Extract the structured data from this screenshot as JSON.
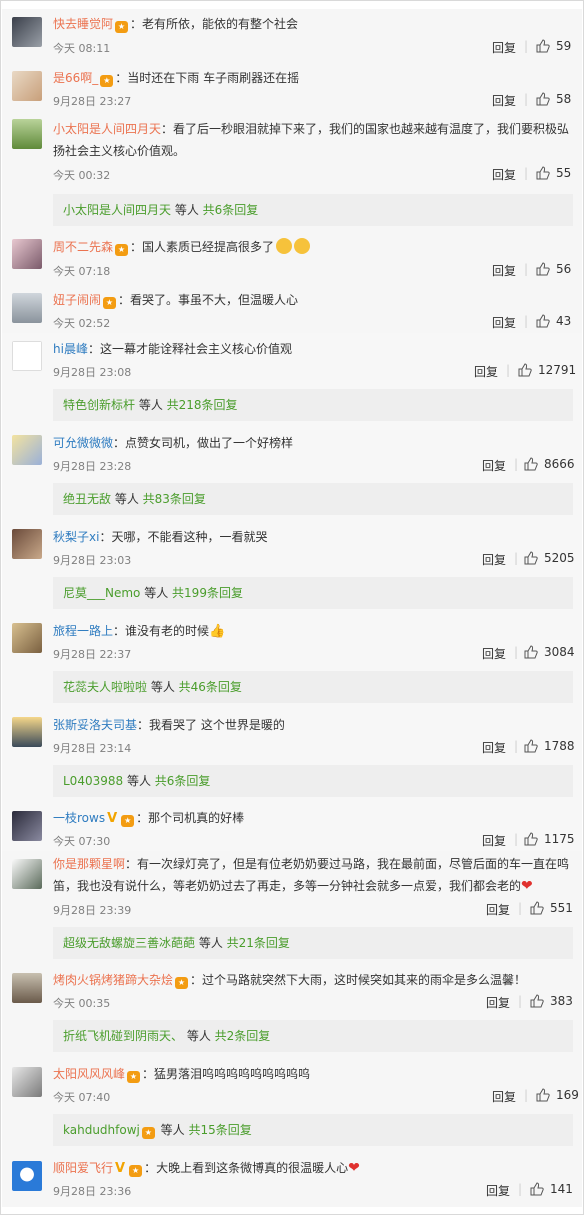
{
  "comments": [
    {
      "user": "快去睡觉阿",
      "badge": "🤩",
      "text": "：老有所依，能依的有整个社会",
      "time": "今天 08:11",
      "reply": "回复",
      "likes": "59"
    },
    {
      "user": "是66啊_",
      "badge": "🤩",
      "text": "：当时还在下雨 车子雨刷器还在摇",
      "time": "9月28日 23:27",
      "reply": "回复",
      "likes": "58"
    },
    {
      "user": "小太阳是人间四月天",
      "text": "：看了后一秒眼泪就掉下来了，我们的国家也越来越有温度了，我们要积极弘",
      "text2": "扬社会主义核心价值观。",
      "time": "今天 00:32",
      "reply": "回复",
      "likes": "55",
      "sub_user": "小太阳是人间四月天",
      "sub_mid": " 等人 ",
      "sub_count": "共6条回复"
    },
    {
      "user": "周不二先森",
      "badge": "🤩",
      "text": "：国人素质已经提高很多了",
      "time": "今天 07:18",
      "reply": "回复",
      "likes": "56"
    },
    {
      "user": "妞子闹闹",
      "badge": "🤩",
      "text": "：看哭了。事虽不大，但温暖人心",
      "time": "今天 02:52",
      "reply": "回复",
      "likes": "43"
    },
    {
      "user": "hi晨峰",
      "text": "：这一幕才能诠释社会主义核心价值观",
      "time": "9月28日 23:08",
      "reply": "回复",
      "likes": "12791",
      "sub_user": "特色创新标杆",
      "sub_mid": " 等人 ",
      "sub_count": "共218条回复"
    },
    {
      "user": "可允微微微",
      "text": "：点赞女司机，做出了一个好榜样",
      "time": "9月28日 23:28",
      "reply": "回复",
      "likes": "8666",
      "sub_user": "绝丑无敌",
      "sub_mid": " 等人 ",
      "sub_count": "共83条回复"
    },
    {
      "user": "秋梨子xi",
      "text": "：天哪，不能看这种，一看就哭",
      "time": "9月28日 23:03",
      "reply": "回复",
      "likes": "5205",
      "sub_user": "尼莫___Nemo",
      "sub_mid": " 等人 ",
      "sub_count": "共199条回复"
    },
    {
      "user": "旅程一路上",
      "text": "：谁没有老的时候",
      "time": "9月28日 22:37",
      "reply": "回复",
      "likes": "3084",
      "sub_user": "花蕊夫人啦啦啦",
      "sub_mid": " 等人 ",
      "sub_count": "共46条回复"
    },
    {
      "user": "张斯妥洛夫司基",
      "text": "：我看哭了 这个世界是暖的",
      "time": "9月28日 23:14",
      "reply": "回复",
      "likes": "1788",
      "sub_user": "L0403988",
      "sub_mid": " 等人 ",
      "sub_count": "共6条回复"
    },
    {
      "user": "一枝rows",
      "badge_v": "V",
      "badge": "🤩",
      "text": "：那个司机真的好棒",
      "time": "今天 07:30",
      "reply": "回复",
      "likes": "1175"
    },
    {
      "user": "你是那颗星啊",
      "text": "：有一次绿灯亮了，但是有位老奶奶要过马路，我在最前面，尽管后面的车一直在鸣",
      "text2": "笛，我也没有说什么，等老奶奶过去了再走，多等一分钟社会就多一点爱，我们都会老的",
      "time": "9月28日 23:39",
      "reply": "回复",
      "likes": "551",
      "sub_user": "超级无敌螺旋三善冰葩葩",
      "sub_mid": " 等人 ",
      "sub_count": "共21条回复"
    },
    {
      "user": "烤肉火锅烤猪蹄大杂烩",
      "badge": "🤩",
      "text": "：过个马路就突然下大雨，这时候突如其来的雨伞是多么温馨！",
      "time": "今天 00:35",
      "reply": "回复",
      "likes": "383",
      "sub_user": "折纸飞机碰到阴雨天、",
      "sub_mid": " 等人 ",
      "sub_count": "共2条回复"
    },
    {
      "user": "太阳风风风峰",
      "badge": "🤩",
      "text": "：猛男落泪呜呜呜呜呜呜呜呜呜",
      "time": "今天 07:40",
      "reply": "回复",
      "likes": "169",
      "sub_user": "kahdudhfowj",
      "sub_badge": "🤩",
      "sub_mid": " 等人 ",
      "sub_count": "共15条回复"
    },
    {
      "user": "顺阳爱飞行",
      "badge_v": "V",
      "badge": "🤩",
      "text": "：大晚上看到这条微博真的很温暖人心",
      "time": "9月28日 23:36",
      "reply": "回复",
      "likes": "141"
    }
  ]
}
